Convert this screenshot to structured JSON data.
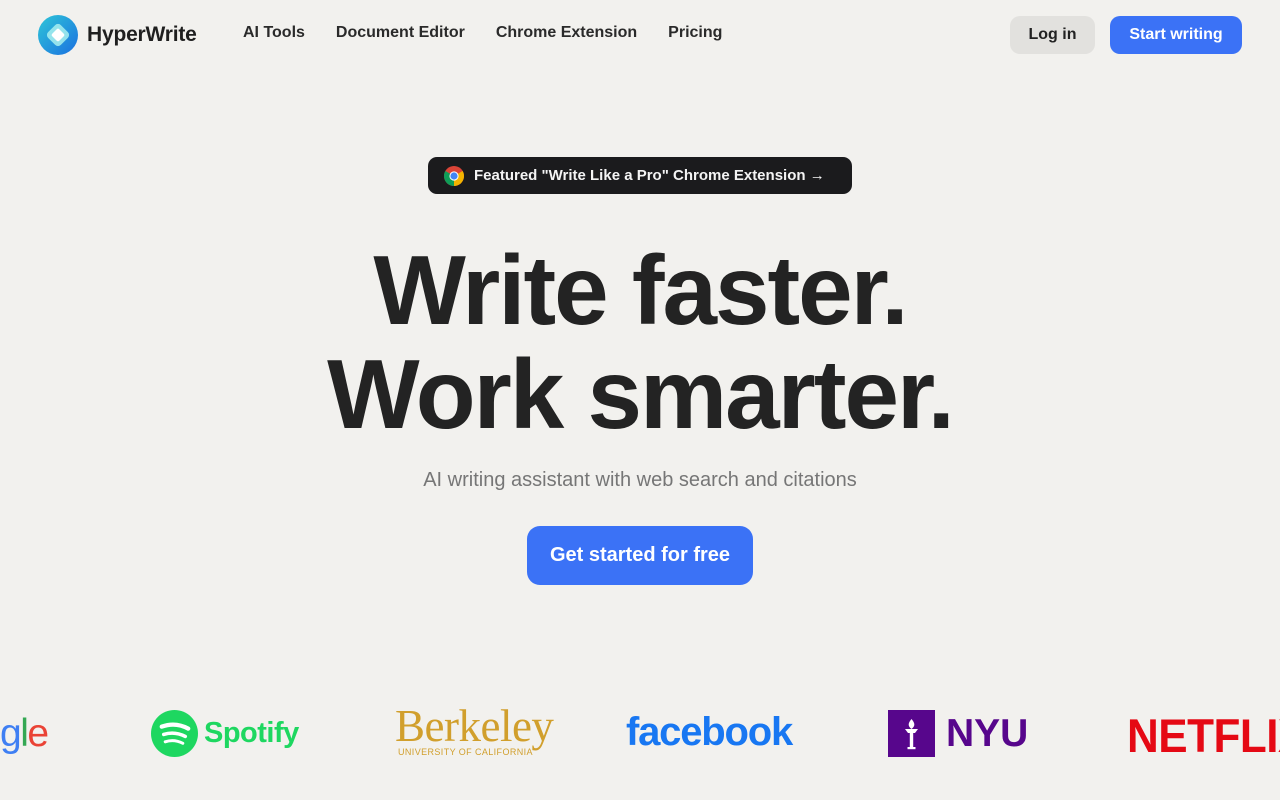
{
  "header": {
    "brand_name": "HyperWrite",
    "nav": [
      "AI Tools",
      "Document Editor",
      "Chrome Extension",
      "Pricing"
    ],
    "login_label": "Log in",
    "start_label": "Start writing"
  },
  "featured": {
    "text": "Featured \"Write Like a Pro\" Chrome Extension →"
  },
  "hero": {
    "line1": "Write faster.",
    "line2": "Work smarter.",
    "subtitle": "AI writing assistant with web search and citations",
    "cta_label": "Get started for free"
  },
  "logos": {
    "google_part_a": "g",
    "google_part_b": "l",
    "google_part_c": "e",
    "spotify": "Spotify",
    "berkeley": "Berkeley",
    "berkeley_sub": "UNIVERSITY OF CALIFORNIA",
    "facebook": "facebook",
    "nyu": "NYU",
    "netflix": "NETFLIX"
  },
  "colors": {
    "accent": "#3b72f6",
    "background": "#f2f1ee",
    "pill_bg": "#1b1b1d"
  }
}
